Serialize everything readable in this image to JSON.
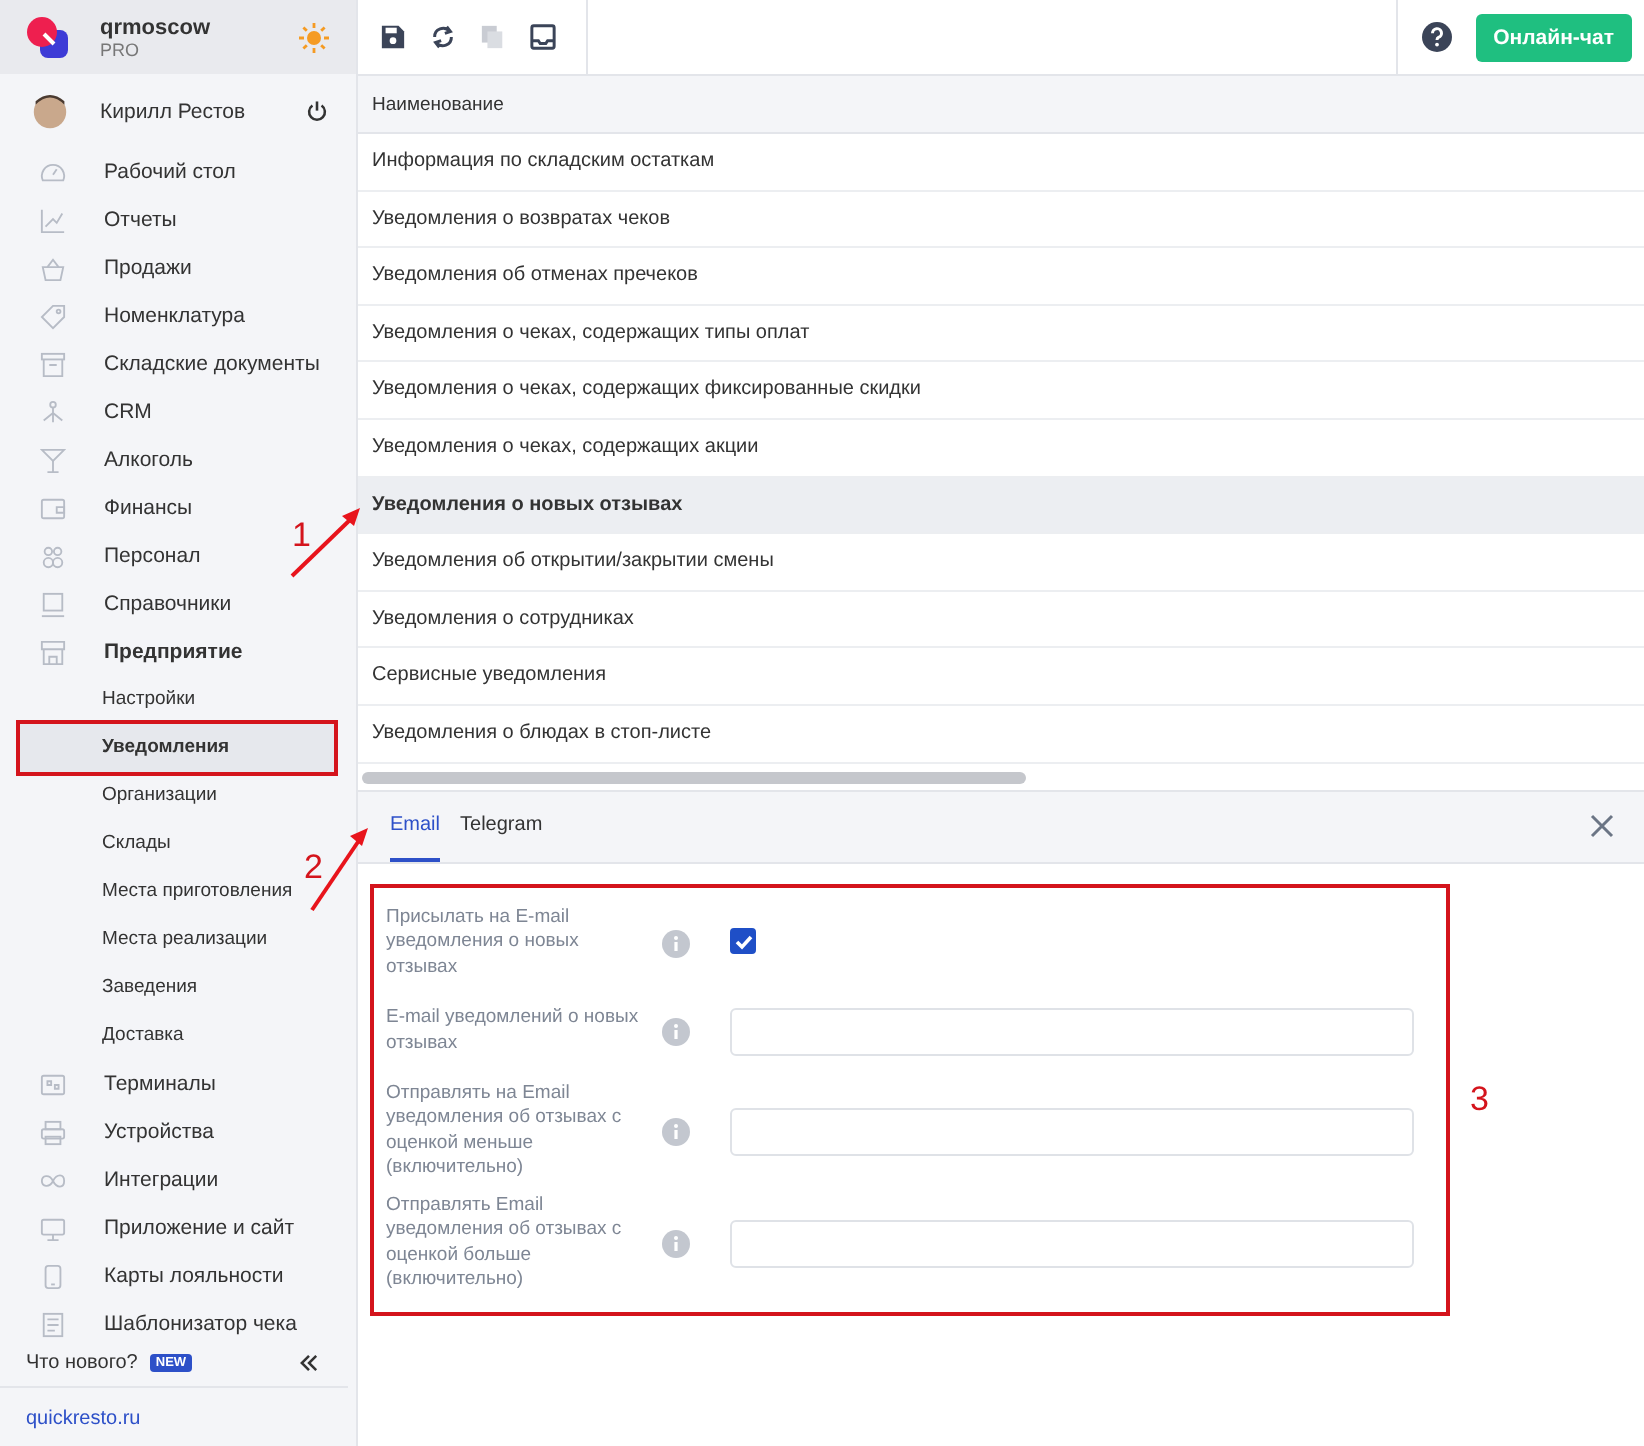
{
  "brand": {
    "name": "qrmoscow",
    "plan": "PRO"
  },
  "user": {
    "name": "Кирилл Рестов"
  },
  "sidebar": {
    "items": [
      {
        "label": "Рабочий стол",
        "selected": false,
        "expanded": false
      },
      {
        "label": "Отчеты",
        "selected": false,
        "expanded": false
      },
      {
        "label": "Продажи",
        "selected": false,
        "expanded": false
      },
      {
        "label": "Номенклатура",
        "selected": false,
        "expanded": false
      },
      {
        "label": "Складские документы",
        "selected": false,
        "expanded": false
      },
      {
        "label": "CRM",
        "selected": false,
        "expanded": false
      },
      {
        "label": "Алкоголь",
        "selected": false,
        "expanded": false
      },
      {
        "label": "Финансы",
        "selected": false,
        "expanded": false
      },
      {
        "label": "Персонал",
        "selected": false,
        "expanded": false
      },
      {
        "label": "Справочники",
        "selected": false,
        "expanded": false
      },
      {
        "label": "Предприятие",
        "selected": false,
        "expanded": true,
        "children": [
          {
            "label": "Настройки",
            "selected": false
          },
          {
            "label": "Уведомления",
            "selected": true
          },
          {
            "label": "Организации",
            "selected": false
          },
          {
            "label": "Склады",
            "selected": false
          },
          {
            "label": "Места приготовления",
            "selected": false
          },
          {
            "label": "Места реализации",
            "selected": false
          },
          {
            "label": "Заведения",
            "selected": false
          },
          {
            "label": "Доставка",
            "selected": false
          }
        ]
      },
      {
        "label": "Терминалы",
        "selected": false,
        "expanded": false
      },
      {
        "label": "Устройства",
        "selected": false,
        "expanded": false
      },
      {
        "label": "Интеграции",
        "selected": false,
        "expanded": false
      },
      {
        "label": "Приложение и сайт",
        "selected": false,
        "expanded": false
      },
      {
        "label": "Карты лояльности",
        "selected": false,
        "expanded": false
      },
      {
        "label": "Шаблонизатор чека",
        "selected": false,
        "expanded": false
      }
    ],
    "whats_new": "Что нового?",
    "new_badge": "NEW",
    "link": "quickresto.ru"
  },
  "toolbar": {
    "chat_button": "Онлайн-чат"
  },
  "table": {
    "columns": [
      "Наименование"
    ],
    "rows": [
      {
        "name": "Информация по складским остаткам",
        "selected": false
      },
      {
        "name": "Уведомления о возвратах чеков",
        "selected": false
      },
      {
        "name": "Уведомления об отменах пречеков",
        "selected": false
      },
      {
        "name": "Уведомления о чеках, содержащих типы оплат",
        "selected": false
      },
      {
        "name": "Уведомления о чеках, содержащих фиксированные скидки",
        "selected": false
      },
      {
        "name": "Уведомления о чеках, содержащих акции",
        "selected": false
      },
      {
        "name": "Уведомления о новых отзывах",
        "selected": true
      },
      {
        "name": "Уведомления об открытии/закрытии смены",
        "selected": false
      },
      {
        "name": "Уведомления о сотрудниках",
        "selected": false
      },
      {
        "name": "Сервисные уведомления",
        "selected": false
      },
      {
        "name": "Уведомления о блюдах в стоп-листе",
        "selected": false
      }
    ]
  },
  "tabs": [
    {
      "label": "Email",
      "selected": true
    },
    {
      "label": "Telegram",
      "selected": false
    }
  ],
  "form": {
    "fields": [
      {
        "kind": "checkbox",
        "label": "Присылать на E-mail уведомления о новых отзывах",
        "checked": true
      },
      {
        "kind": "text",
        "label": "E-mail уведомлений о новых отзывах"
      },
      {
        "kind": "text",
        "label": "Отправлять на Email уведомления об отзывах с оценкой меньше (включительно)"
      },
      {
        "kind": "text",
        "label": "Отправлять Email уведомления об отзывах с оценкой больше (включительно)"
      }
    ]
  },
  "annotations": [
    {
      "kind": "arrow",
      "label": "1"
    },
    {
      "kind": "arrow",
      "label": "2"
    },
    {
      "kind": "mark",
      "label": "3"
    }
  ]
}
